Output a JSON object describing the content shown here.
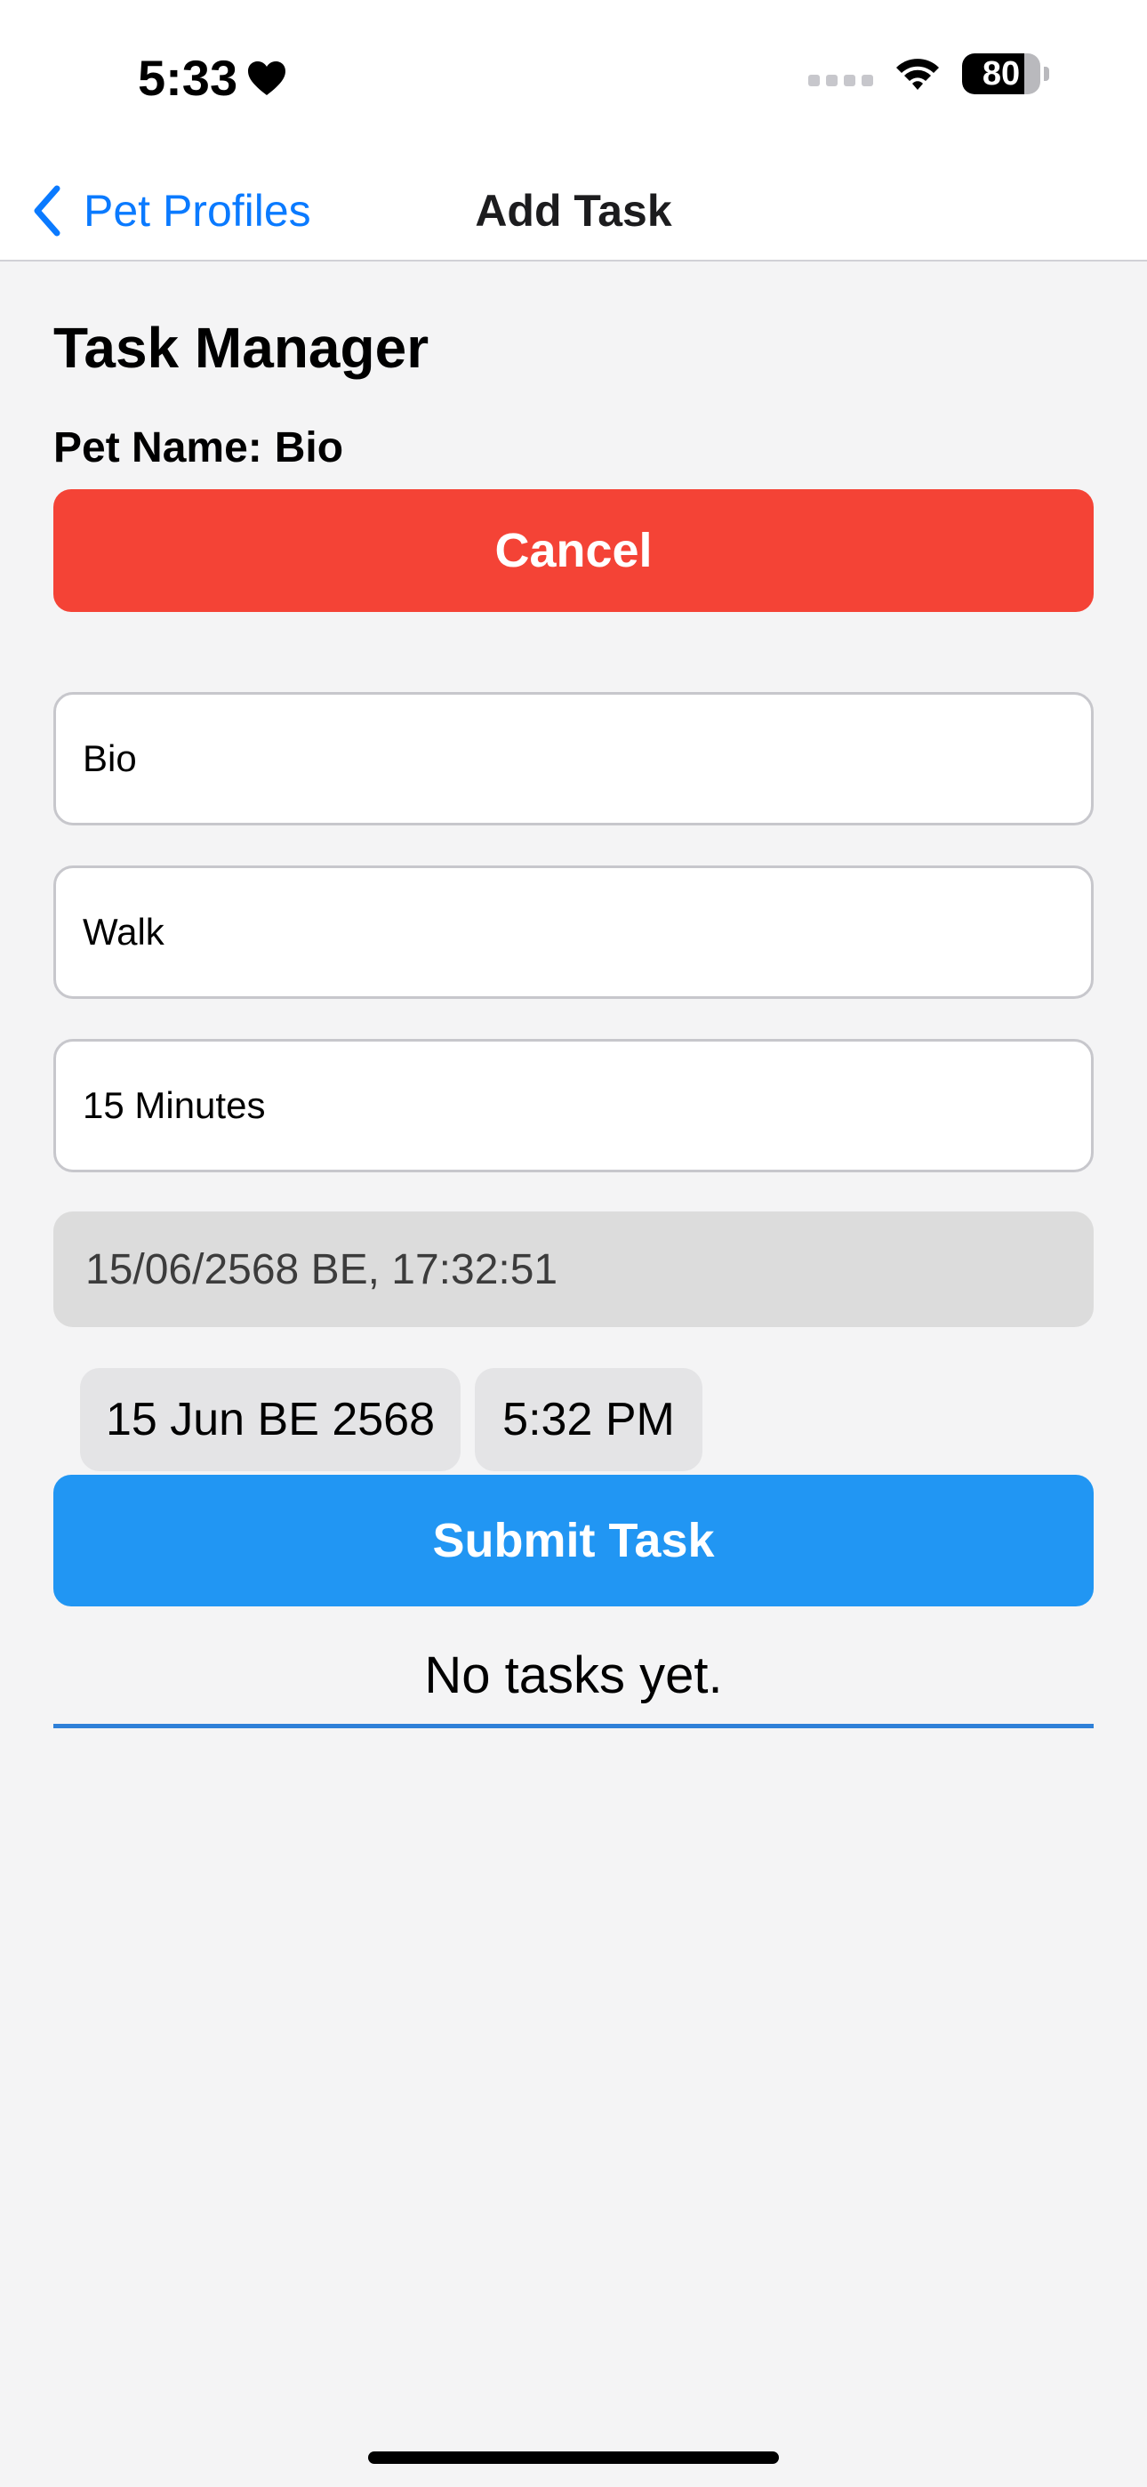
{
  "status_bar": {
    "time": "5:33",
    "battery": "80",
    "battery_level": 0.8
  },
  "nav": {
    "back_label": "Pet Profiles",
    "title": "Add Task"
  },
  "main": {
    "title": "Task Manager",
    "pet_name_label": "Pet Name:",
    "pet_name_value": "Bio",
    "cancel_label": "Cancel",
    "fields": {
      "pet_name": "Bio",
      "task": "Walk",
      "duration": "15 Minutes"
    },
    "datetime_display": "15/06/2568 BE, 17:32:51",
    "date_picker": "15 Jun BE 2568",
    "time_picker": "5:32 PM",
    "submit_label": "Submit Task",
    "empty_state": "No tasks yet."
  },
  "colors": {
    "accent": "#0a7aff",
    "cancel": "#f44336",
    "submit": "#2196f3"
  }
}
